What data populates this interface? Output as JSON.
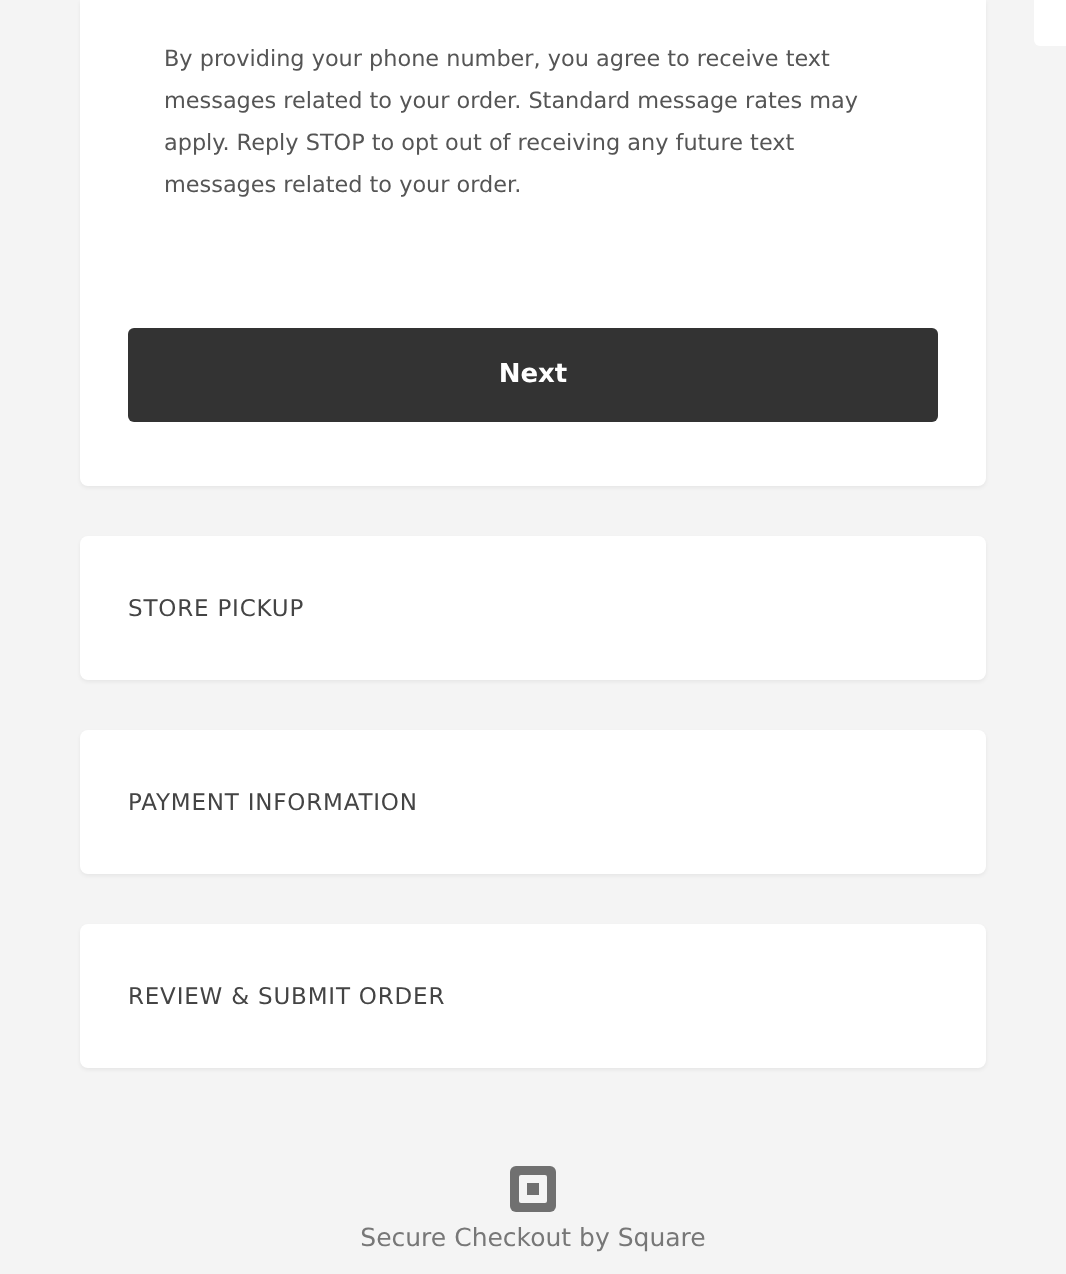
{
  "consent_text": "By providing your phone number, you agree to receive text messages related to your order. Standard message rates may apply. Reply STOP to opt out of receiving any future text messages related to your order.",
  "next_button": "Next",
  "sections": [
    {
      "title": "STORE PICKUP"
    },
    {
      "title": "PAYMENT INFORMATION"
    },
    {
      "title": "REVIEW & SUBMIT ORDER"
    }
  ],
  "footer": "Secure Checkout by Square"
}
